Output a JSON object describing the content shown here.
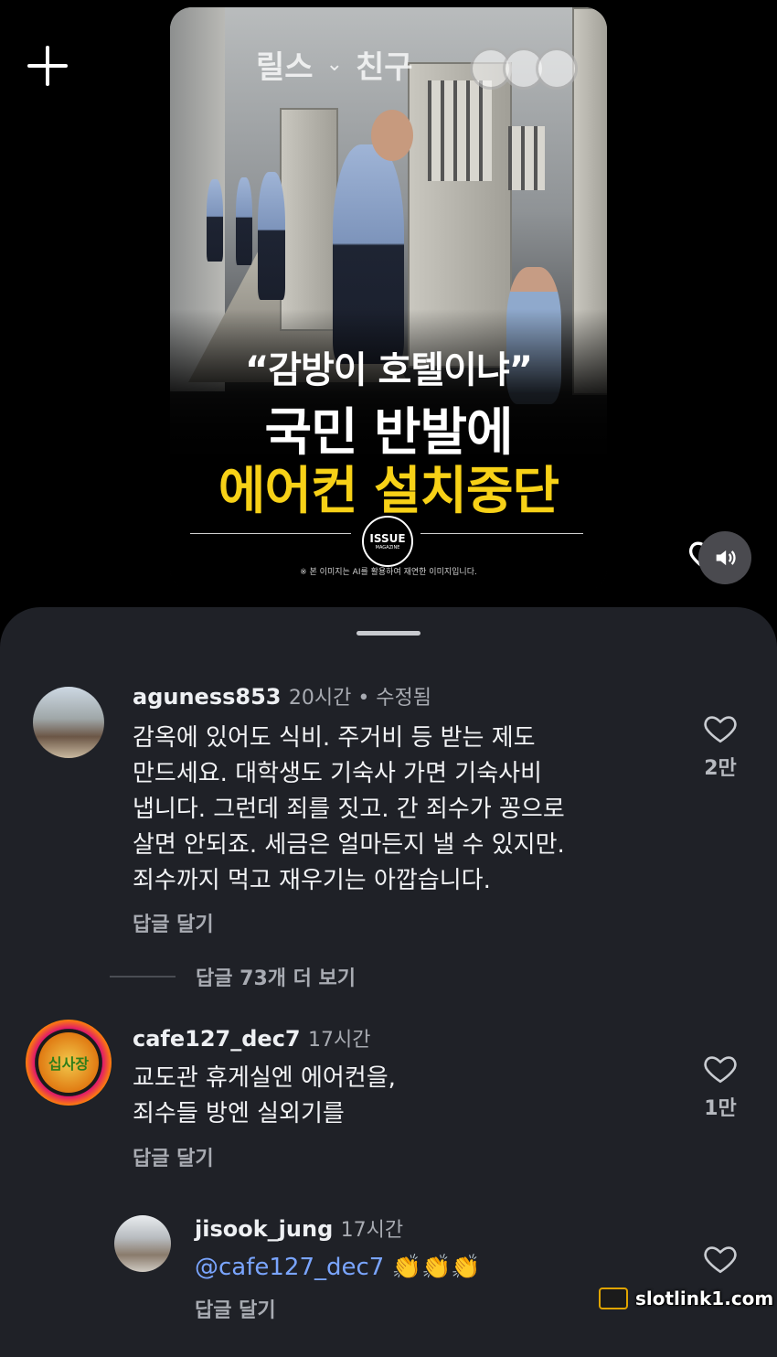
{
  "reel": {
    "tab_reels": "릴스",
    "tab_friends": "친구",
    "headline_1": "“감방이 호텔이냐”",
    "headline_2": "국민 반발에",
    "headline_3": "에어컨 설치중단",
    "logo_line1": "ISSUE",
    "logo_line2": "MAGAZINE",
    "disclaimer": "※ 본 이미지는 AI를 활용하여 재연한 이미지입니다."
  },
  "comments": [
    {
      "username": "aguness853",
      "meta": "20시간 • 수정됨",
      "lines": [
        "감옥에 있어도  식비. 주거비 등 받는 제도",
        "만드세요. 대학생도 기숙사 가면 기숙사비",
        "냅니다.  그런데 죄를 짓고. 간 죄수가 꽁으로",
        "살면 안되죠.  세금은 얼마든지 낼 수 있지만.",
        "죄수까지 먹고 재우기는 아깝습니다."
      ],
      "reply_label": "답글 달기",
      "likes": "2만"
    },
    {
      "username": "cafe127_dec7",
      "meta": "17시간",
      "avatar_text": "십사장",
      "lines": [
        "교도관 휴게실엔 에어컨을,",
        "죄수들 방엔 실외기를"
      ],
      "reply_label": "답글 달기",
      "likes": "1만"
    },
    {
      "username": "jisook_jung",
      "meta": "17시간",
      "mention": "@cafe127_dec7",
      "emoji": "👏👏👏",
      "reply_label": "답글 달기"
    }
  ],
  "more_replies": "답글 73개 더 보기",
  "watermark": "slotlink1.com"
}
